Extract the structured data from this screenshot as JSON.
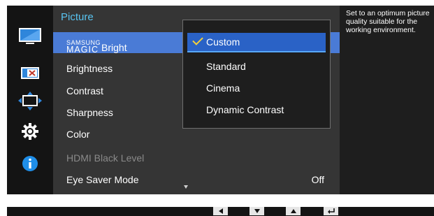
{
  "menu": {
    "title": "Picture",
    "magic_brand_top": "SAMSUNG",
    "magic_brand_bottom": "MAGIC",
    "magic_rest": "Bright",
    "items": [
      {
        "label": "Brightness"
      },
      {
        "label": "Contrast"
      },
      {
        "label": "Sharpness"
      },
      {
        "label": "Color"
      },
      {
        "label": "HDMI Black Level",
        "disabled": true
      },
      {
        "label": "Eye Saver Mode",
        "value": "Off"
      }
    ]
  },
  "dropdown": {
    "options": [
      "Custom",
      "Standard",
      "Cinema",
      "Dynamic Contrast"
    ],
    "selected": "Custom"
  },
  "help": {
    "text": "Set to an optimum picture quality suitable for the working environment."
  },
  "colors": {
    "accent_title": "#58c3f0",
    "selected_row": "#4a7bd6",
    "selected_option": "#2a62c6",
    "check": "#f4d03a"
  },
  "icons": [
    "picture-icon",
    "onscreen-display-icon",
    "position-resize-icon",
    "settings-gear-icon",
    "info-icon"
  ],
  "nav_buttons": [
    "left-arrow-icon",
    "down-arrow-icon",
    "up-arrow-icon",
    "enter-icon"
  ]
}
